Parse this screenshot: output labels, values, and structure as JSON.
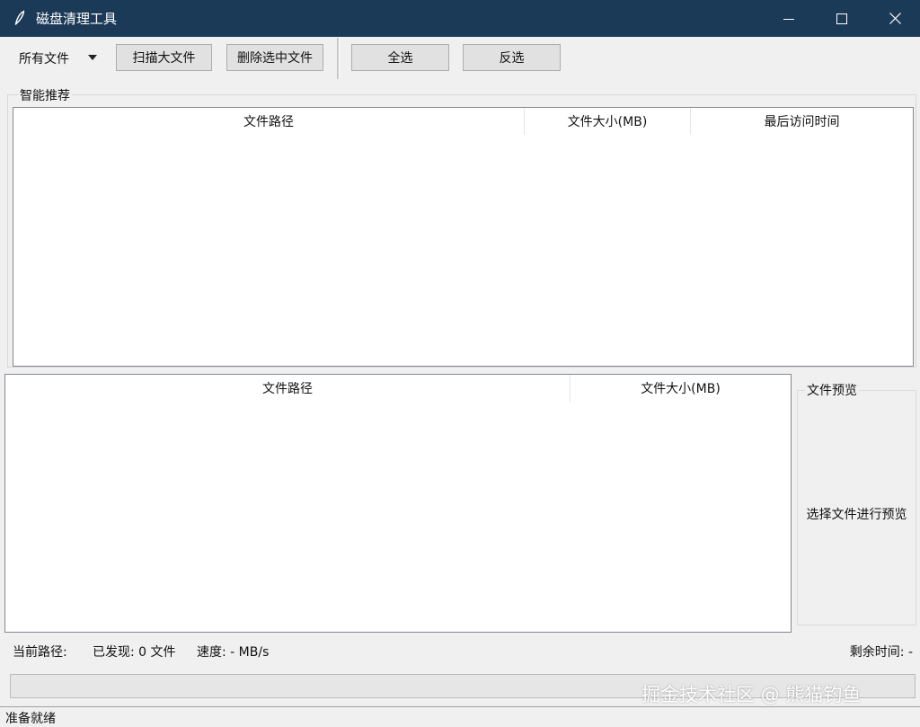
{
  "window": {
    "title": "磁盘清理工具"
  },
  "toolbar": {
    "file_type_selected": "所有文件",
    "scan_button": "扫描大文件",
    "delete_button": "删除选中文件",
    "select_all_button": "全选",
    "invert_selection_button": "反选"
  },
  "recommendations": {
    "group_label": "智能推荐",
    "columns": [
      "文件路径",
      "文件大小(MB)",
      "最后访问时间"
    ]
  },
  "file_list": {
    "columns": [
      "文件路径",
      "文件大小(MB)"
    ]
  },
  "preview": {
    "group_label": "文件预览",
    "placeholder": "选择文件进行预览"
  },
  "status": {
    "current_path": "当前路径:",
    "found": "已发现: 0 文件",
    "speed": "速度: - MB/s",
    "remaining": "剩余时间: -",
    "progress": 0,
    "bar_text": "准备就绪"
  },
  "watermark": "掘金技术社区 @ 熊猫钓鱼",
  "colors": {
    "titlebar": "#1b3a57",
    "window_background": "#f0f0f0"
  },
  "icons": {
    "app": "feather-icon",
    "minimize": "minimize-icon",
    "maximize": "maximize-icon",
    "close": "close-icon",
    "dropdown": "caret-down-icon"
  }
}
